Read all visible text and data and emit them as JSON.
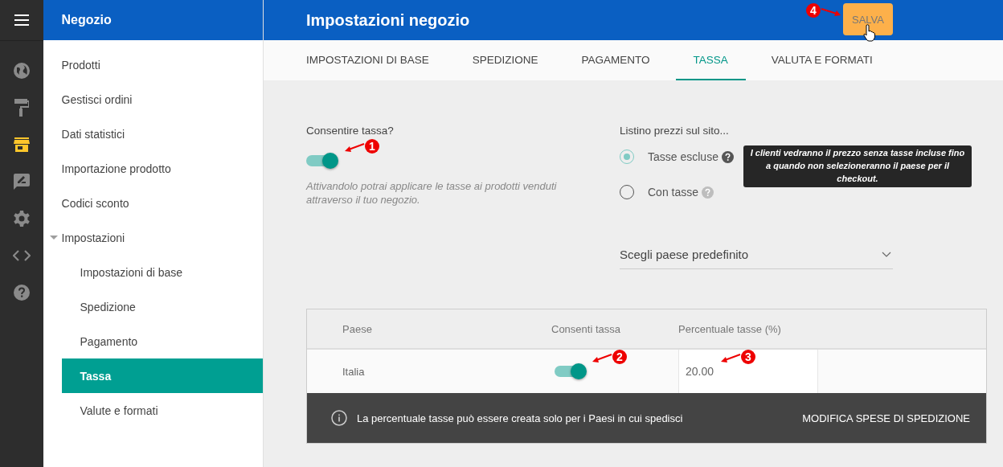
{
  "rail": {
    "items": [
      {
        "kind": "globe",
        "selected": false
      },
      {
        "kind": "roller",
        "selected": false
      },
      {
        "kind": "store",
        "selected": true
      },
      {
        "kind": "feedback",
        "selected": false
      },
      {
        "kind": "gear",
        "selected": false
      },
      {
        "kind": "code",
        "selected": false
      },
      {
        "kind": "help",
        "selected": false
      }
    ]
  },
  "nav": {
    "title": "Negozio",
    "items": [
      {
        "label": "Prodotti",
        "selected": false
      },
      {
        "label": "Gestisci ordini",
        "selected": false
      },
      {
        "label": "Dati statistici",
        "selected": false
      },
      {
        "label": "Importazione prodotto",
        "selected": false
      },
      {
        "label": "Codici sconto",
        "selected": false
      },
      {
        "label": "Impostazioni",
        "selected": false,
        "expanded": true,
        "children": [
          {
            "label": "Impostazioni di base",
            "selected": false
          },
          {
            "label": "Spedizione",
            "selected": false
          },
          {
            "label": "Pagamento",
            "selected": false
          },
          {
            "label": "Tassa",
            "selected": true
          },
          {
            "label": "Valute e formati",
            "selected": false
          }
        ]
      }
    ]
  },
  "header": {
    "title": "Impostazioni negozio",
    "save_button": "SALVA"
  },
  "tabs": [
    {
      "label": "IMPOSTAZIONI DI BASE",
      "selected": false
    },
    {
      "label": "SPEDIZIONE",
      "selected": false
    },
    {
      "label": "PAGAMENTO",
      "selected": false
    },
    {
      "label": "TASSA",
      "selected": true
    },
    {
      "label": "VALUTA E FORMATI",
      "selected": false
    }
  ],
  "tax_toggle": {
    "label": "Consentire tassa?",
    "on": true,
    "description": "Attivandolo potrai applicare le tasse ai prodotti venduti attraverso il tuo negozio."
  },
  "price_list": {
    "label": "Listino prezzi sul sito...",
    "options": [
      {
        "label": "Tasse escluse",
        "selected": true,
        "help_active": true
      },
      {
        "label": "Con tasse",
        "selected": false,
        "help_active": false
      }
    ],
    "tooltip": "I clienti vedranno il prezzo senza tasse incluse fino a quando non selezioneranno il paese per il checkout."
  },
  "country_select": {
    "placeholder": "Scegli paese predefinito"
  },
  "table": {
    "columns": [
      "Paese",
      "Consenti tassa",
      "Percentuale tasse (%)"
    ],
    "rows": [
      {
        "country": "Italia",
        "allowed": true,
        "rate": "20.00"
      }
    ]
  },
  "notice": {
    "text": "La percentuale tasse può essere creata solo per i Paesi in cui spedisci",
    "action": "MODIFICA SPESE DI SPEDIZIONE"
  },
  "callouts": [
    "1",
    "2",
    "3",
    "4"
  ]
}
